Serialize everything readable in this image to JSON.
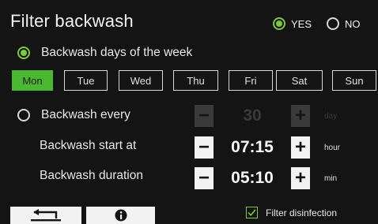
{
  "header": {
    "title": "Filter backwash"
  },
  "enable": {
    "yes_label": "YES",
    "no_label": "NO",
    "selected": "YES"
  },
  "mode": {
    "days_label": "Backwash days of the week",
    "every_label": "Backwash every",
    "selected": "days"
  },
  "days": [
    {
      "label": "Mon",
      "active": true
    },
    {
      "label": "Tue",
      "active": false
    },
    {
      "label": "Wed",
      "active": false
    },
    {
      "label": "Thu",
      "active": false
    },
    {
      "label": "Fri",
      "active": false
    },
    {
      "label": "Sat",
      "active": false
    },
    {
      "label": "Sun",
      "active": false
    }
  ],
  "every": {
    "value": "30",
    "unit": "day",
    "minus": "−",
    "plus": "+"
  },
  "start": {
    "label": "Backwash start at",
    "value": "07:15",
    "unit": "hour",
    "minus": "−",
    "plus": "+"
  },
  "duration": {
    "label": "Backwash duration",
    "value": "05:10",
    "unit": "min",
    "minus": "−",
    "plus": "+"
  },
  "disinfection": {
    "label": "Filter disinfection",
    "checked": true
  },
  "colors": {
    "accent": "#4bb832",
    "radio": "#7cc840",
    "background": "#141414",
    "button": "#f2f2f2",
    "disabled": "#3a3a3a"
  },
  "icons": {
    "back": "return-arrow-icon",
    "info": "info-icon",
    "check": "checkmark-icon"
  }
}
